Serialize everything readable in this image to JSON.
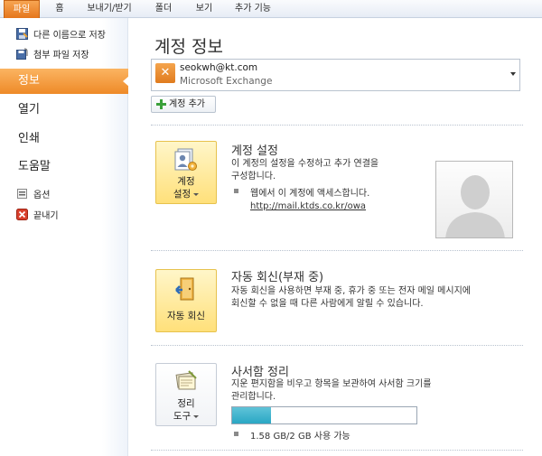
{
  "ribbon": {
    "tabs": [
      {
        "label": "파일",
        "active": true
      },
      {
        "label": "홈"
      },
      {
        "label": "보내기/받기"
      },
      {
        "label": "폴더"
      },
      {
        "label": "보기"
      },
      {
        "label": "추가 기능"
      }
    ]
  },
  "nav": {
    "commands": [
      {
        "label": "다른 이름으로 저장",
        "icon": "save-as-icon"
      },
      {
        "label": "첨부 파일 저장",
        "icon": "save-attachments-icon"
      }
    ],
    "items": [
      {
        "label": "정보",
        "selected": true
      },
      {
        "label": "열기"
      },
      {
        "label": "인쇄"
      },
      {
        "label": "도움말"
      }
    ],
    "bottom_commands": [
      {
        "label": "옵션",
        "icon": "options-icon"
      },
      {
        "label": "끝내기",
        "icon": "exit-icon"
      }
    ]
  },
  "main": {
    "title": "계정 정보",
    "account": {
      "email": "seokwh@kt.com",
      "type": "Microsoft Exchange"
    },
    "add_account_label": "계정 추가",
    "sections": {
      "account_settings": {
        "button_label_1": "계정",
        "button_label_2": "설정",
        "title": "계정 설정",
        "desc_line_1": "이 계정의 설정을 수정하고 추가 연결을",
        "desc_line_2": "구성합니다.",
        "bullet_text": "웹에서 이 계정에 액세스합니다.",
        "link": "http://mail.ktds.co.kr/owa"
      },
      "auto_reply": {
        "button_label": "자동 회신",
        "title": "자동 회신(부재 중)",
        "desc_line_1": "자동 회신을 사용하면 부재 중, 휴가 중 또는 전자 메일 메시지에",
        "desc_line_2": "회신할 수 없을 때 다른 사람에게 알릴 수 있습니다."
      },
      "cleanup": {
        "button_label_1": "정리",
        "button_label_2": "도구",
        "title": "사서함 정리",
        "desc_line_1": "지운 편지함을 비우고 항목을 보관하여 사서함 크기를",
        "desc_line_2": "관리합니다.",
        "quota_fraction": 0.21,
        "quota_text": "1.58 GB/2 GB 사용 가능"
      }
    }
  },
  "colors": {
    "file_tab": "#e5761c",
    "selected_nav": "#ee8a28",
    "big_button": "#ffe07a",
    "quota_fill": "#2aa7c4"
  }
}
